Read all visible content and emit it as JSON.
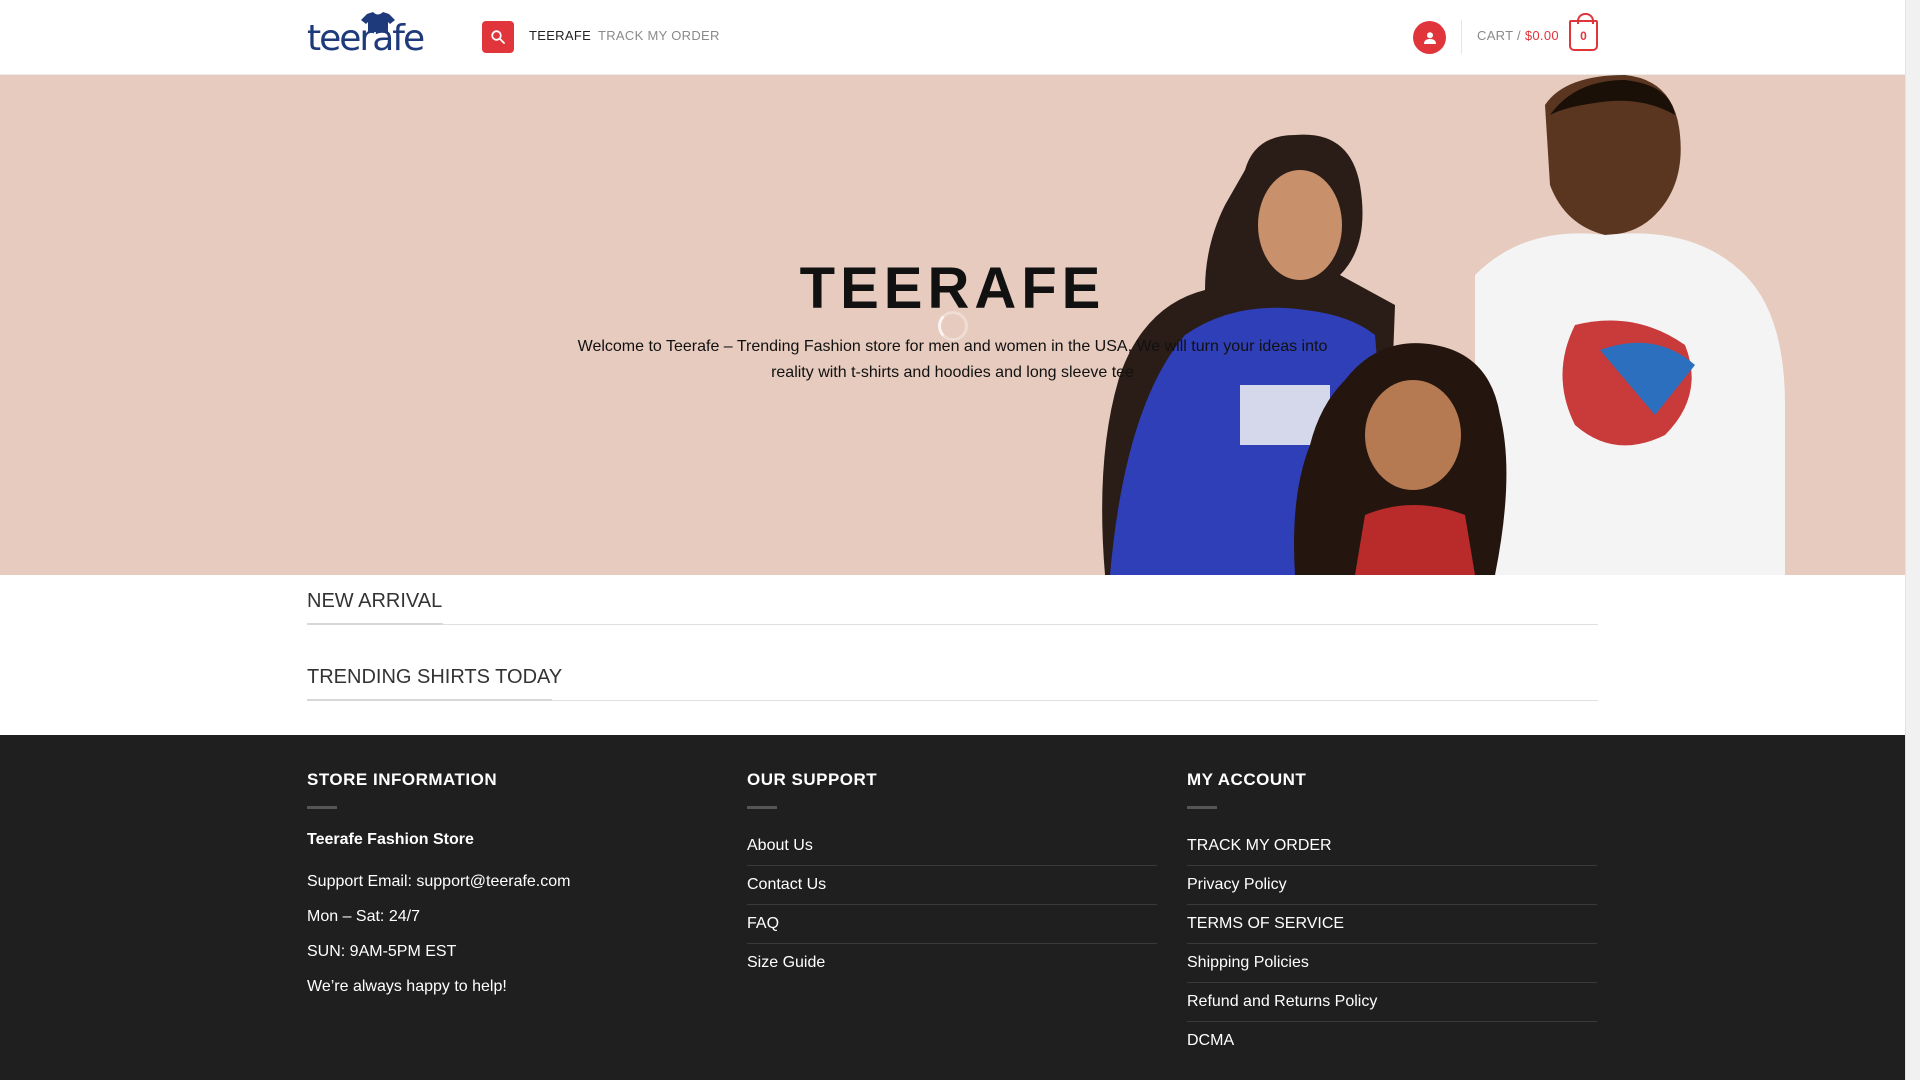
{
  "header": {
    "logo_text": "teerafe",
    "nav": [
      {
        "label": "TEERAFE"
      },
      {
        "label": "TRACK MY ORDER"
      }
    ],
    "cart_label": "CART /",
    "cart_amount": "$0.00",
    "cart_count": "0"
  },
  "hero": {
    "title": "TEERAFE",
    "subtitle": "Welcome to Teerafe – Trending Fashion store for men and women in the USA, We will turn your ideas into reality with t-shirts and hoodies and long sleeve tee"
  },
  "sections": [
    {
      "title": "NEW ARRIVAL"
    },
    {
      "title": "TRENDING SHIRTS TODAY"
    }
  ],
  "footer": {
    "store": {
      "heading": "STORE INFORMATION",
      "name": "Teerafe Fashion Store",
      "lines": [
        "Support Email: support@teerafe.com",
        "Mon – Sat: 24/7",
        "SUN: 9AM-5PM EST",
        "We’re always happy to help!"
      ]
    },
    "support": {
      "heading": "OUR SUPPORT",
      "links": [
        "About Us",
        "Contact Us",
        "FAQ",
        "Size Guide"
      ]
    },
    "account": {
      "heading": "MY ACCOUNT",
      "links": [
        "TRACK MY ORDER",
        "Privacy Policy",
        "TERMS OF SERVICE",
        "Shipping Policies",
        "Refund and Returns Policy",
        "DCMA"
      ]
    }
  },
  "colors": {
    "accent": "#e0353a",
    "hero_bg": "#e6cbbe",
    "footer_bg": "#1f1f1f",
    "logo_navy": "#1e3a7b"
  }
}
